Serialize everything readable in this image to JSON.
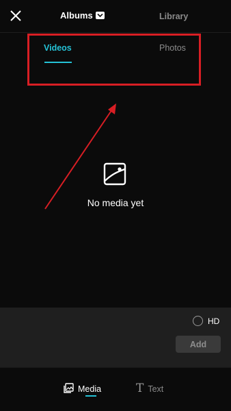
{
  "header": {
    "albums_label": "Albums",
    "library_label": "Library",
    "close_icon": "close-icon",
    "chevron_icon": "chevron-down-icon"
  },
  "tabs": {
    "videos_label": "Videos",
    "photos_label": "Photos",
    "active": "Videos"
  },
  "empty_state": {
    "icon": "image-placeholder-icon",
    "text": "No media yet"
  },
  "options": {
    "hd_label": "HD",
    "hd_checked": false,
    "add_label": "Add"
  },
  "bottom_nav": {
    "media_label": "Media",
    "text_label": "Text",
    "active": "Media"
  },
  "colors": {
    "accent": "#25c2d6",
    "annotation": "#d81e24",
    "background": "#0b0b0b",
    "panel": "#1f1f1f"
  }
}
